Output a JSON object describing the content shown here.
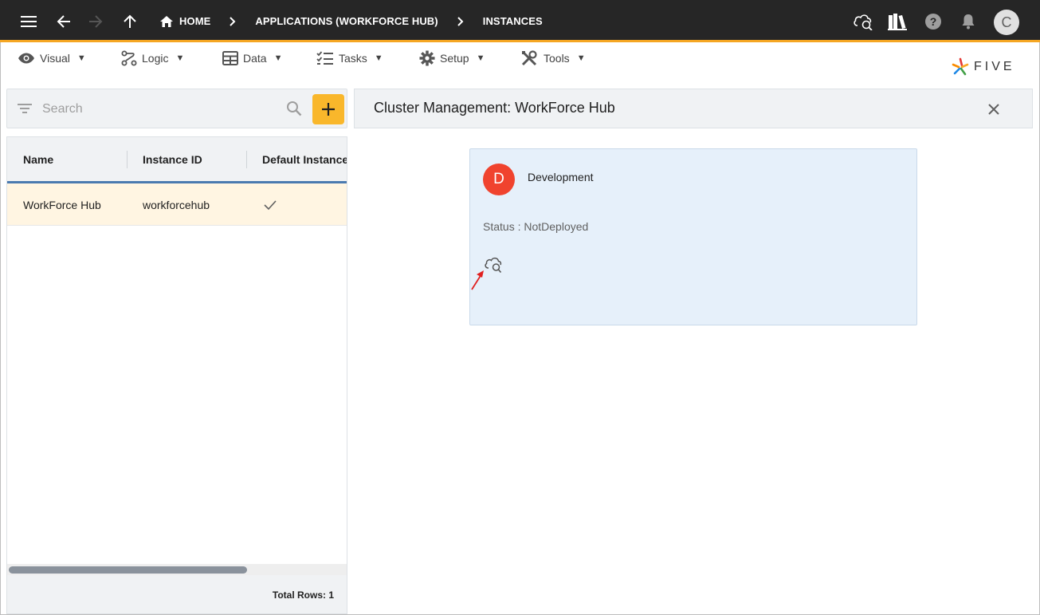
{
  "topbar": {
    "breadcrumbs": [
      "HOME",
      "APPLICATIONS (WORKFORCE HUB)",
      "INSTANCES"
    ],
    "avatar_letter": "C"
  },
  "menu": [
    {
      "label": "Visual",
      "icon": "eye-icon"
    },
    {
      "label": "Logic",
      "icon": "logic-icon"
    },
    {
      "label": "Data",
      "icon": "table-icon"
    },
    {
      "label": "Tasks",
      "icon": "tasks-icon"
    },
    {
      "label": "Setup",
      "icon": "gear-icon"
    },
    {
      "label": "Tools",
      "icon": "tools-icon"
    }
  ],
  "logo": {
    "text": "FIVE"
  },
  "search": {
    "placeholder": "Search"
  },
  "grid": {
    "columns": [
      "Name",
      "Instance ID",
      "Default Instance"
    ],
    "rows": [
      {
        "name": "WorkForce Hub",
        "instance_id": "workforcehub",
        "default": "✓"
      }
    ],
    "footer": "Total Rows: 1"
  },
  "panel": {
    "title": "Cluster Management: WorkForce Hub",
    "card": {
      "avatar_letter": "D",
      "name": "Development",
      "status": "Status : NotDeployed"
    }
  },
  "colors": {
    "topbar_bg": "#262626",
    "accent": "#f5a623",
    "add_button": "#f9b72b",
    "card_bg": "#e6f0fa",
    "card_avatar": "#f0432e",
    "selected_row": "#fff5e2",
    "header_underline": "#4a7ab0"
  }
}
